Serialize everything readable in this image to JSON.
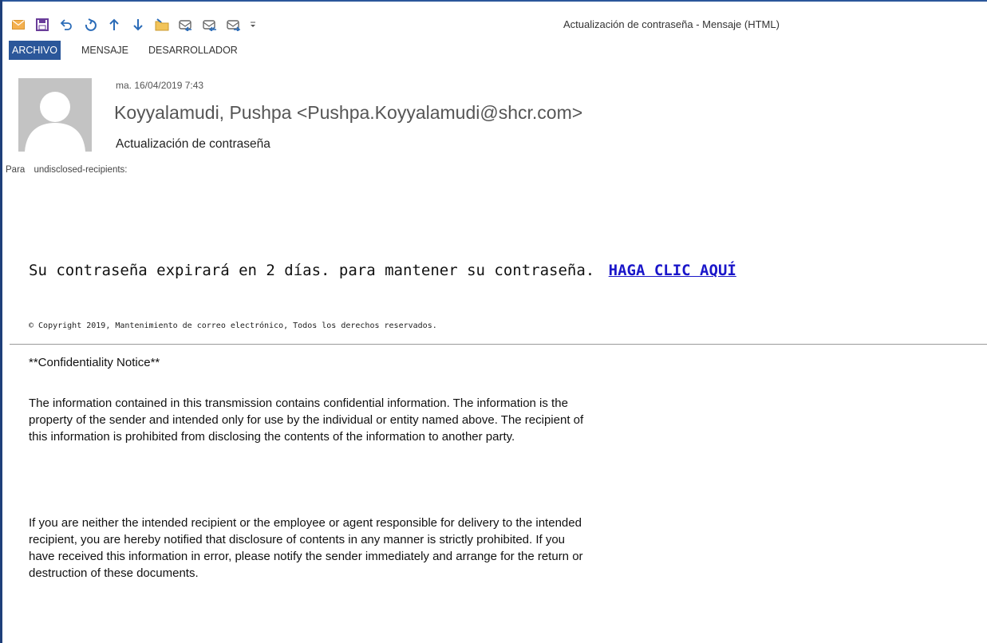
{
  "window": {
    "title": "Actualización de contraseña - Mensaje (HTML)"
  },
  "quick_access_toolbar": {
    "icons": [
      "mail-icon",
      "save-icon",
      "undo-icon",
      "redo-icon",
      "previous-item-icon",
      "next-item-icon",
      "move-to-folder-icon",
      "reply-icon",
      "reply-all-icon",
      "forward-icon",
      "customize-toolbar-icon"
    ]
  },
  "ribbon": {
    "tabs": [
      "ARCHIVO",
      "MENSAJE",
      "DESARROLLADOR"
    ],
    "active_tab": "ARCHIVO",
    "accent_color": "#2b579a"
  },
  "message": {
    "date": "ma. 16/04/2019 7:43",
    "sender": "Koyyalamudi, Pushpa <Pushpa.Koyyalamudi@shcr.com>",
    "subject": "Actualización de contraseña",
    "to_label": "Para",
    "to_value": "undisclosed-recipients:"
  },
  "body": {
    "main_text": "Su contraseña expirará en 2 días. para mantener su contraseña.",
    "link_text": "HAGA CLIC AQUÍ",
    "link_color": "#1a16c9",
    "copyright": "© Copyright 2019, Mantenimiento de correo electrónico, Todos los derechos reservados.",
    "confidentiality_title": "**Confidentiality Notice**",
    "paragraph_1": "The information contained in this transmission contains confidential information. The information is the property of the sender and intended only for use by the individual or entity named above. The recipient of this information is prohibited from disclosing the contents of the information to another party.",
    "paragraph_2": "If you are neither the intended recipient or the employee or agent responsible for delivery to the intended recipient, you are hereby notified that disclosure of contents in any manner is strictly prohibited. If you have received this information in error, please notify the sender immediately and arrange for the return or destruction of these documents."
  }
}
